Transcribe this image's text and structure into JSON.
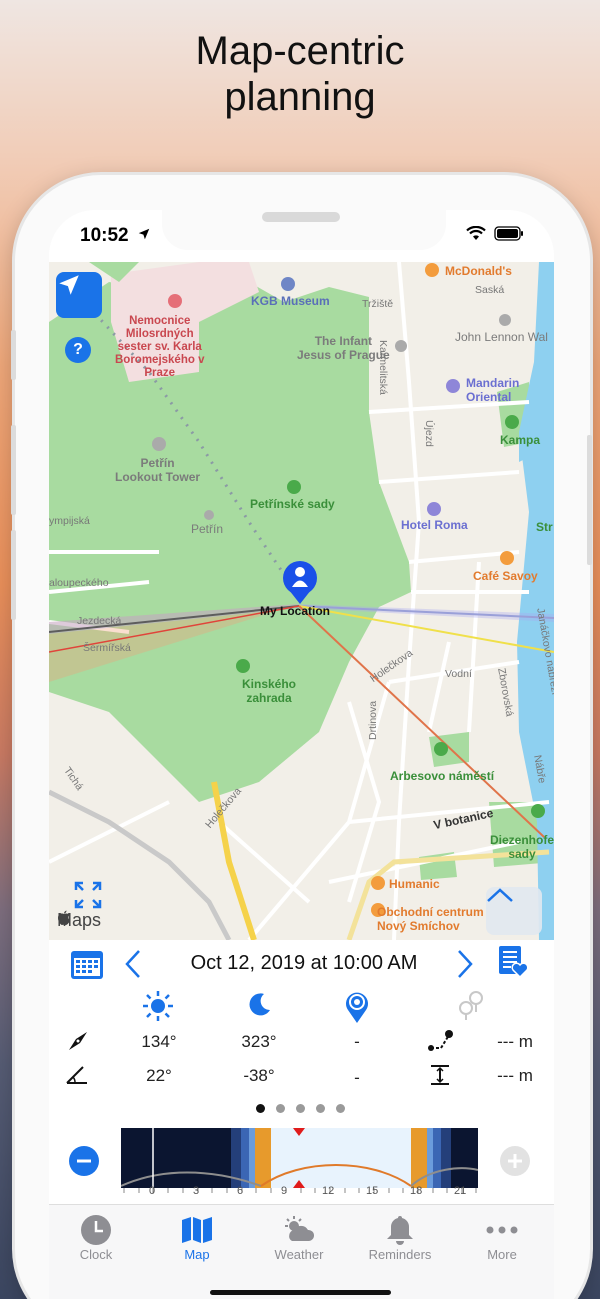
{
  "headline": [
    "Map-centric",
    "planning"
  ],
  "status": {
    "time": "10:52"
  },
  "map": {
    "labels": {
      "trziste": "Tržiště",
      "mcdonalds": "McDonald's",
      "saska": "Saská",
      "kgb": "KGB Museum",
      "hospital": "Nemocnice\nMilosrdných\nsester sv. Karla\nBoromejského v\nPraze",
      "infant": "The Infant\nJesus of Prague",
      "lennon": "John Lennon Wal",
      "karmelitska": "Karmelitská",
      "mandarin": "Mandarin\nOriental",
      "kampa": "Kampa",
      "ujezd": "Újezd",
      "petrin_tower": "Petřín\nLookout Tower",
      "petrinske": "Petřínské sady",
      "petrin": "Petřín",
      "hotel_roma": "Hotel Roma",
      "str": "Str",
      "ympijska": "ympijská",
      "aloupeckeho": "aloupeckého",
      "cafe_savoy": "Café Savoy",
      "my_location": "My Location",
      "jezdecka": "Jezdecká",
      "sermirska": "Šermířská",
      "kinskeho": "Kinského\nzahrada",
      "holeckova": "Holečkova",
      "vodni": "Vodní",
      "zborovska": "Zborovská",
      "janackovo": "Janáčkovo nábřeží",
      "drtinova": "Drtinova",
      "arbesovo": "Arbesovo náměstí",
      "ticha": "Tichá",
      "holeckova2": "Holečkova",
      "nabr": "Nábře",
      "v_botanice": "V botanice",
      "diezenhofer": "Diezenhofe\nsady",
      "humanic": "Humanic",
      "obchodni": "Obchodní centrum\nNový Smíchov",
      "maps": "Maps"
    }
  },
  "date": "Oct 12, 2019 at 10:00 AM",
  "table": {
    "row1": {
      "sun": "134°",
      "moon": "323°",
      "target": "-",
      "distance": "--- m"
    },
    "row2": {
      "sun": "22°",
      "moon": "-38°",
      "target": "-",
      "height": "--- m"
    }
  },
  "timeline_ticks": [
    "0",
    "3",
    "6",
    "9",
    "12",
    "15",
    "18",
    "21"
  ],
  "tabs": [
    {
      "label": "Clock"
    },
    {
      "label": "Map"
    },
    {
      "label": "Weather"
    },
    {
      "label": "Reminders"
    },
    {
      "label": "More"
    }
  ],
  "colors": {
    "accent": "#1a73e8",
    "park": "#a8dba0",
    "sun_line": "#f0e04a",
    "moon_line": "#6f6f9c"
  }
}
